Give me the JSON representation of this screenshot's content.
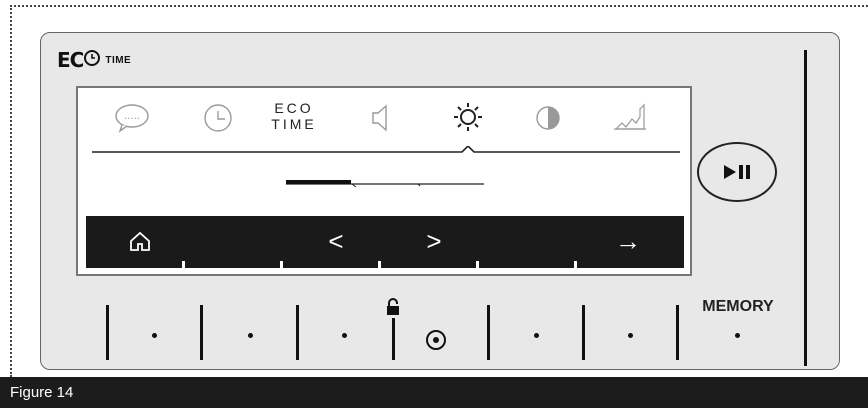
{
  "brand": {
    "eco": "EC",
    "time": "TIME"
  },
  "screen": {
    "menu_icons": [
      "speech-bubble-icon",
      "clock-icon",
      "eco-time",
      "speaker-icon",
      "brightness-icon",
      "contrast-icon",
      "graph-icon"
    ],
    "eco_time_line1": "ECO",
    "eco_time_line2": "TIME",
    "selected_menu": "brightness",
    "brightness_level": 0.33
  },
  "nav": {
    "home": "home-icon",
    "prev": "<",
    "next": ">",
    "enter": "→"
  },
  "controls": {
    "play_pause": "play-pause-icon",
    "memory_label": "MEMORY"
  },
  "caption": {
    "text": "Figure 14"
  },
  "colors": {
    "panel": "#e8e8e8",
    "bar": "#1a1a1a",
    "screen": "#ffffff"
  }
}
